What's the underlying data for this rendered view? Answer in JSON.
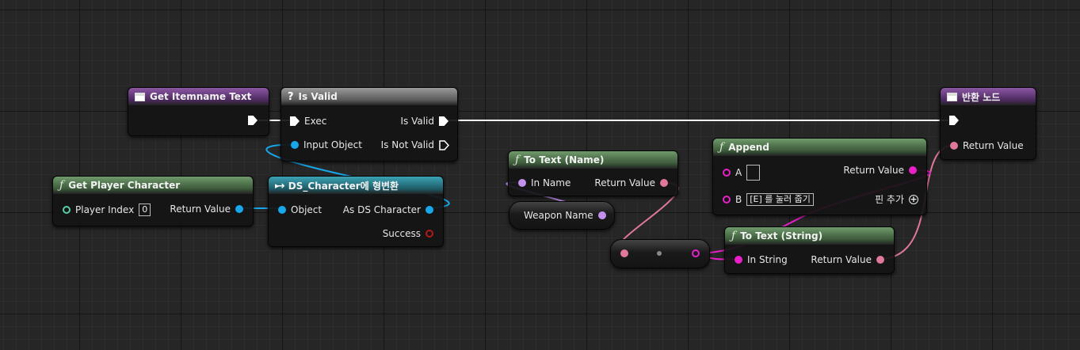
{
  "nodes": {
    "get_itemname_text": {
      "title": "Get Itemname Text"
    },
    "is_valid": {
      "title": "Is Valid",
      "exec_in": "Exec",
      "input_object": "Input Object",
      "is_valid_out": "Is Valid",
      "is_not_valid_out": "Is Not Valid"
    },
    "get_player_character": {
      "title": "Get Player Character",
      "player_index_label": "Player Index",
      "player_index_value": "0",
      "return_value": "Return Value"
    },
    "cast": {
      "title": "DS_Character에 형변환",
      "object": "Object",
      "as_ds_character": "As DS Character",
      "success": "Success"
    },
    "to_text_name": {
      "title": "To Text (Name)",
      "in_name": "In Name",
      "return_value": "Return Value"
    },
    "weapon_name": {
      "label": "Weapon Name"
    },
    "append": {
      "title": "Append",
      "a_label": "A",
      "a_value": "",
      "b_label": "B",
      "b_value": "[E] 를 눌러 줍기",
      "return_value": "Return Value",
      "add_pin": "핀 추가"
    },
    "to_text_string": {
      "title": "To Text (String)",
      "in_string": "In String",
      "return_value": "Return Value"
    },
    "return_node": {
      "title": "반환 노드",
      "return_value": "Return Value"
    }
  },
  "colors": {
    "object_pin": "#18a7ea",
    "name_pin": "#c390ee",
    "text_pin": "#e0789a",
    "string_pin": "#e91fc8",
    "exec_wire": "#ffffff"
  }
}
